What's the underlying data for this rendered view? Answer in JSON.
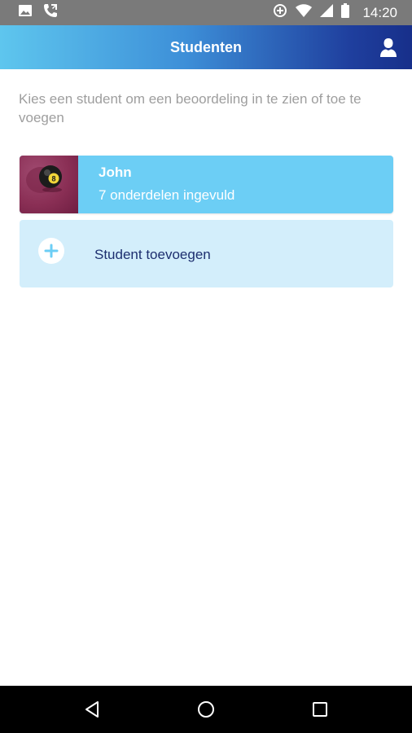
{
  "status_bar": {
    "time": "14:20",
    "left_icons": [
      "image-icon",
      "phone-call-icon"
    ],
    "right_icons": [
      "data-saver-icon",
      "wifi-icon",
      "signal-icon",
      "battery-icon"
    ]
  },
  "app_bar": {
    "title": "Studenten",
    "action_icon": "person-icon"
  },
  "intro": {
    "text": "Kies een student om een beoordeling in te zien of toe te voegen"
  },
  "students": [
    {
      "name": "John",
      "progress": "7 onderdelen ingevuld",
      "avatar_icon": "eight-ball-photo"
    }
  ],
  "add_student": {
    "label": "Student toevoegen",
    "icon": "plus-icon"
  },
  "nav_bar": {
    "buttons": [
      "back-icon",
      "home-icon",
      "recents-icon"
    ]
  },
  "colors": {
    "status_bar": "#7a7a7a",
    "app_bar_start": "#5ec6ee",
    "app_bar_end": "#172f8a",
    "student_card": "#6ccef5",
    "add_card": "#d3eefb",
    "add_label": "#1d2f6f",
    "intro_text": "#9e9e9e"
  }
}
